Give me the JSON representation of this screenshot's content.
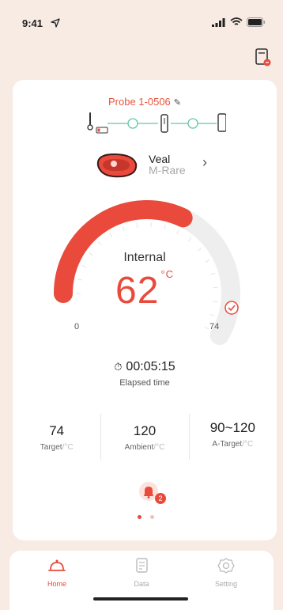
{
  "status_bar": {
    "time": "9:41"
  },
  "probe": {
    "name": "Probe 1-0506"
  },
  "food": {
    "name": "Veal",
    "doneness": "M-Rare"
  },
  "gauge": {
    "label": "Internal",
    "temperature": "62",
    "unit": "°C",
    "min": "0",
    "max": "74",
    "progress_fraction": 0.55
  },
  "timer": {
    "time": "00:05:15",
    "label": "Elapsed time"
  },
  "stats": [
    {
      "value": "74",
      "label": "Target",
      "unit": "/°C"
    },
    {
      "value": "120",
      "label": "Ambient",
      "unit": "/°C"
    },
    {
      "value": "90~120",
      "label": "A-Target",
      "unit": "/°C"
    }
  ],
  "alarm": {
    "count": "2"
  },
  "tabs": [
    {
      "label": "Home",
      "icon": "home-icon"
    },
    {
      "label": "Data",
      "icon": "data-icon"
    },
    {
      "label": "Setting",
      "icon": "gear-icon"
    }
  ],
  "colors": {
    "accent": "#e94a3b",
    "background": "#f7ebe3",
    "link": "#61c7a8"
  }
}
